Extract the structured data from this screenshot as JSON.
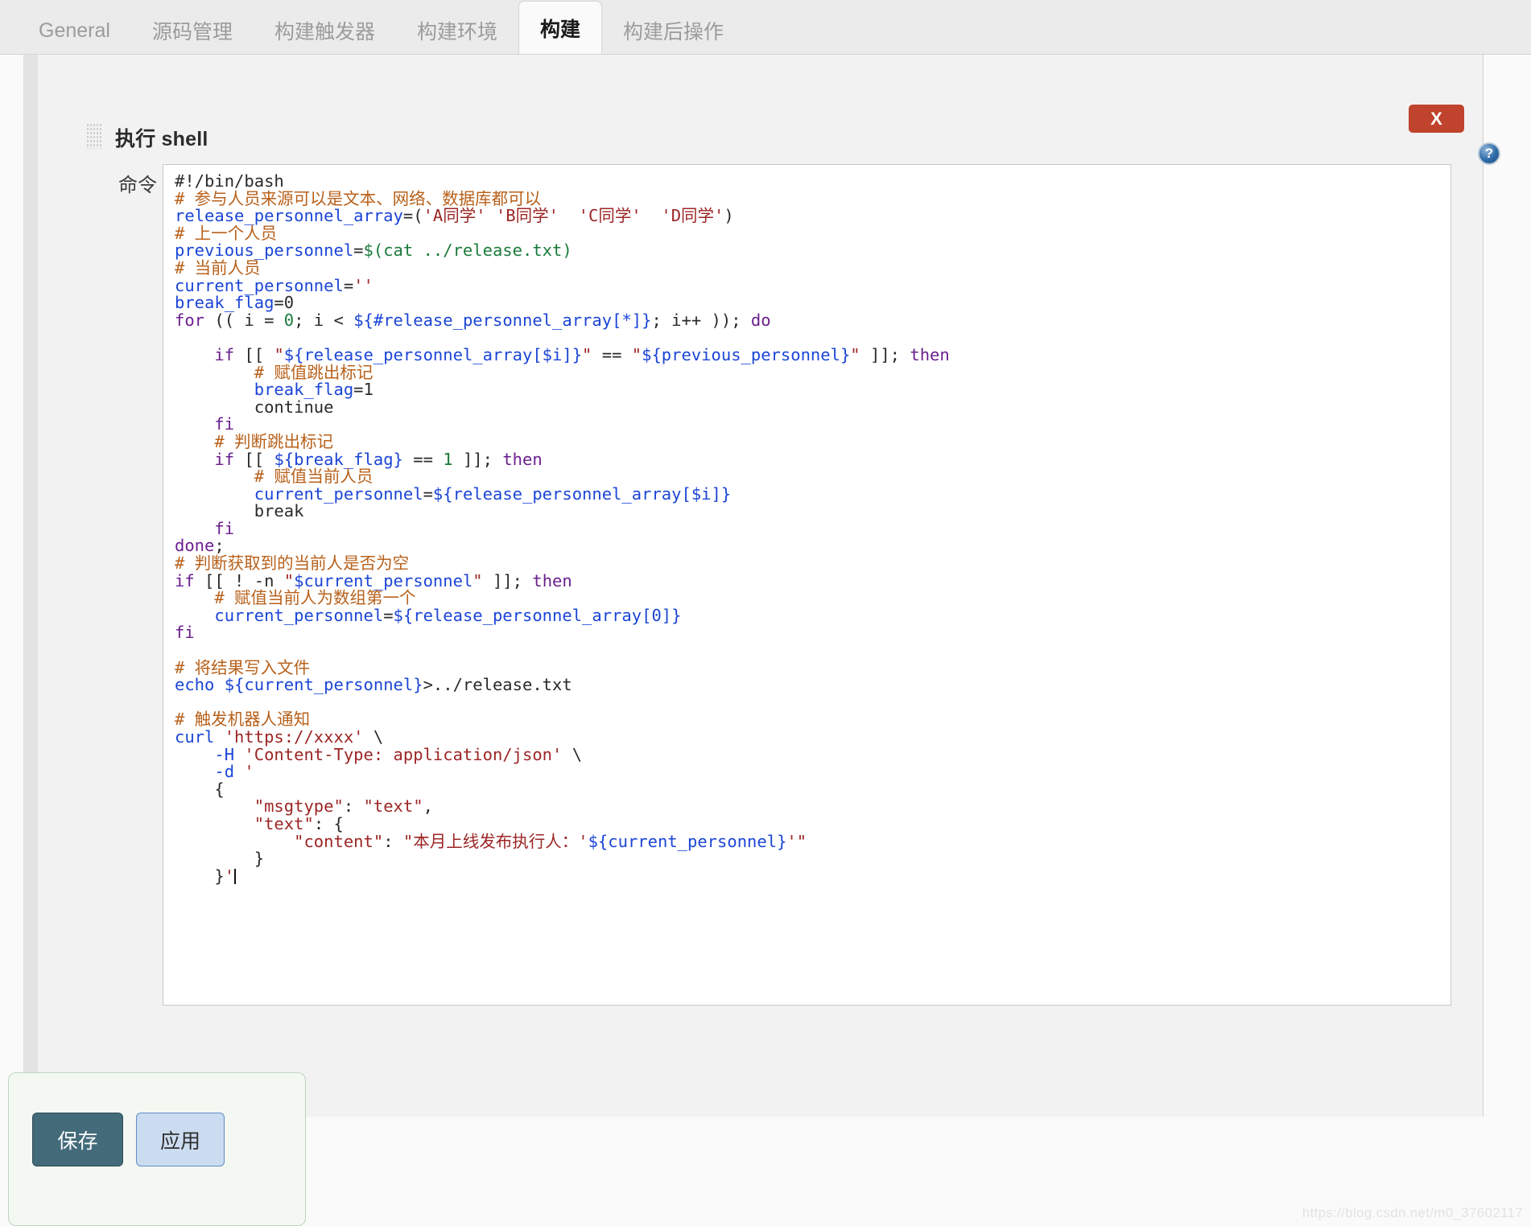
{
  "tabs": [
    {
      "label": "General",
      "active": false
    },
    {
      "label": "源码管理",
      "active": false
    },
    {
      "label": "构建触发器",
      "active": false
    },
    {
      "label": "构建环境",
      "active": false
    },
    {
      "label": "构建",
      "active": true
    },
    {
      "label": "构建后操作",
      "active": false
    }
  ],
  "block": {
    "title": "执行 shell",
    "grip_icon": "drag-grip-icon",
    "delete_label": "X",
    "help_label": "?"
  },
  "form": {
    "command_label": "命令",
    "command_value": "#!/bin/bash\n# 参与人员来源可以是文本、网络、数据库都可以\nrelease_personnel_array=('A同学' 'B同学' 'C同学' 'D同学')\n# 上一个人员\nprevious_personnel=$(cat ../release.txt)\n# 当前人员\ncurrent_personnel=''\nbreak_flag=0\nfor (( i = 0; i < ${#release_personnel_array[*]}; i++ )); do\n\n    if [[ \"${release_personnel_array[$i]}\" == \"${previous_personnel}\" ]]; then\n        # 赋值跳出标记\n        break_flag=1\n        continue\n    fi\n    # 判断跳出标记\n    if [[ ${break_flag} == 1 ]]; then\n        # 赋值当前人员\n        current_personnel=${release_personnel_array[$i]}\n        break\n    fi\ndone;\n# 判断获取到的当前人是否为空\nif [[ ! -n \"$current_personnel\" ]]; then\n    # 赋值当前人为数组第一个\n    current_personnel=${release_personnel_array[0]}\nfi\n\n# 将结果写入文件\necho ${current_personnel}>../release.txt\n\n# 触发机器人通知\ncurl 'https://xxxx' \\\n    -H 'Content-Type: application/json' \\\n    -d '\n    {\n        \"msgtype\": \"text\",\n        \"text\": {\n            \"content\": \"本月上线发布执行人：'${current_personnel}'\"\n        }\n    }'"
  },
  "footer": {
    "save_label": "保存",
    "apply_label": "应用"
  },
  "watermark": "https://blog.csdn.net/m0_37602117",
  "colors": {
    "tab_active_bg": "#fafafa",
    "tabbar_bg": "#ebebeb",
    "delete_button": "#c0432e",
    "save_button": "#436b7a",
    "apply_button": "#ccdcf0",
    "comment": "#b8611b",
    "variable": "#1b45d6",
    "string": "#9c2525",
    "keyword": "#6b1f8e",
    "number": "#1a7a3c"
  }
}
